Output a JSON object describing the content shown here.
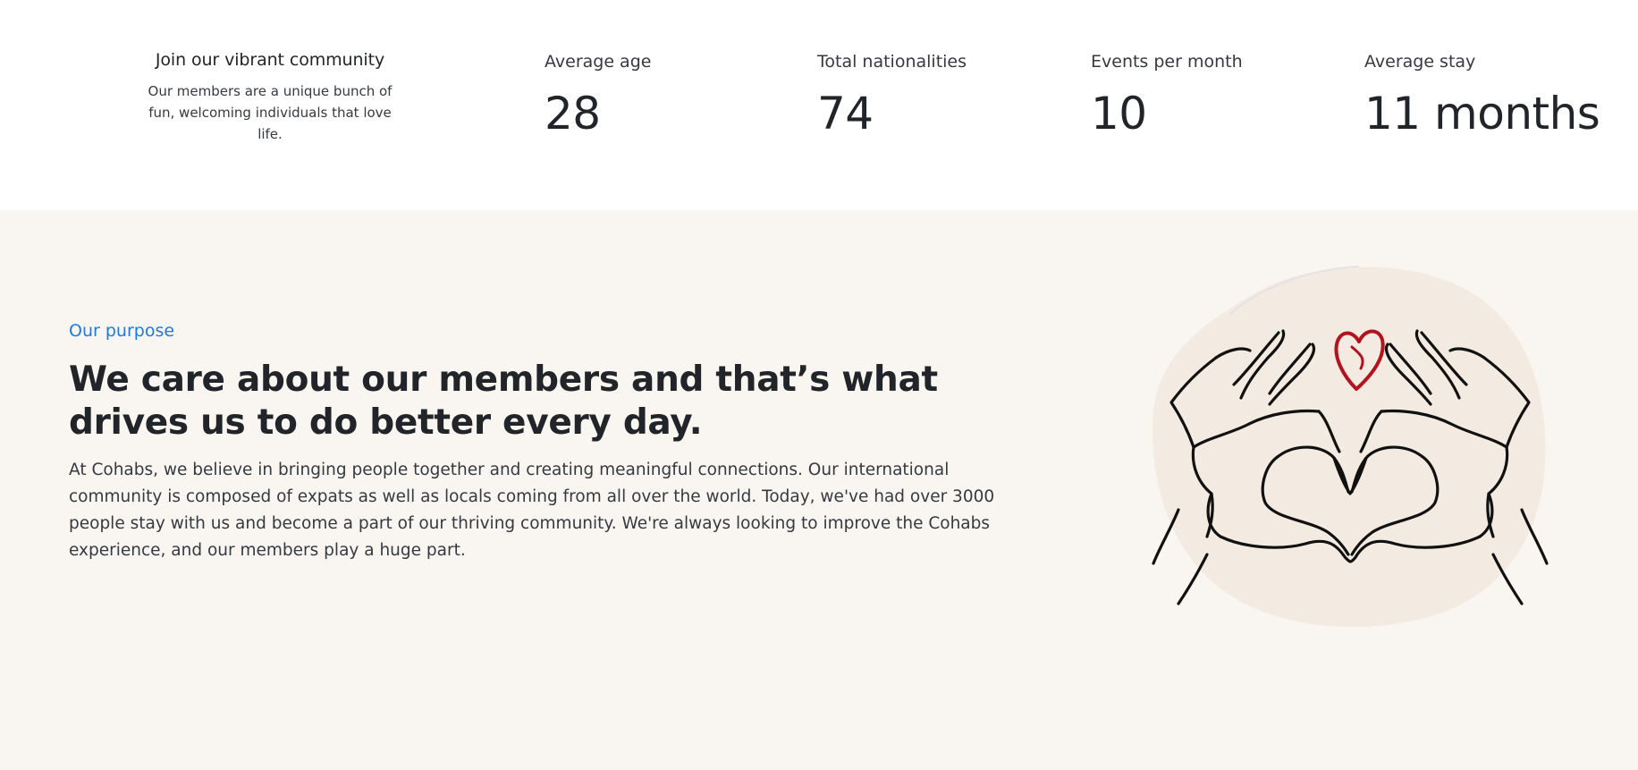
{
  "stats_section": {
    "intro": {
      "title": "Join our vibrant community",
      "text": "Our members are a unique bunch of fun, welcoming individuals that love life."
    },
    "stats": [
      {
        "label": "Average age",
        "value": "28"
      },
      {
        "label": "Total nationalities",
        "value": "74"
      },
      {
        "label": "Events per month",
        "value": "10"
      },
      {
        "label": "Average stay",
        "value": "11 months"
      }
    ]
  },
  "purpose_section": {
    "eyebrow": "Our purpose",
    "headline": "We care about our members and that’s what drives us to do better every day.",
    "body": "At Cohabs, we believe in bringing people together and creating meaningful connections. Our international community is composed of expats as well as locals coming from all over the world. Today, we've had over 3000 people stay with us and become a part of our thriving community. We're always looking to improve the Cohabs experience, and our members play a huge part.",
    "illustration_icon": "heart-hands-icon"
  },
  "colors": {
    "accent": "#1a7ae6",
    "section_bg": "#f9f6f2",
    "blob": "#f3ebe1",
    "heart": "#b3121f",
    "text": "#212529"
  }
}
